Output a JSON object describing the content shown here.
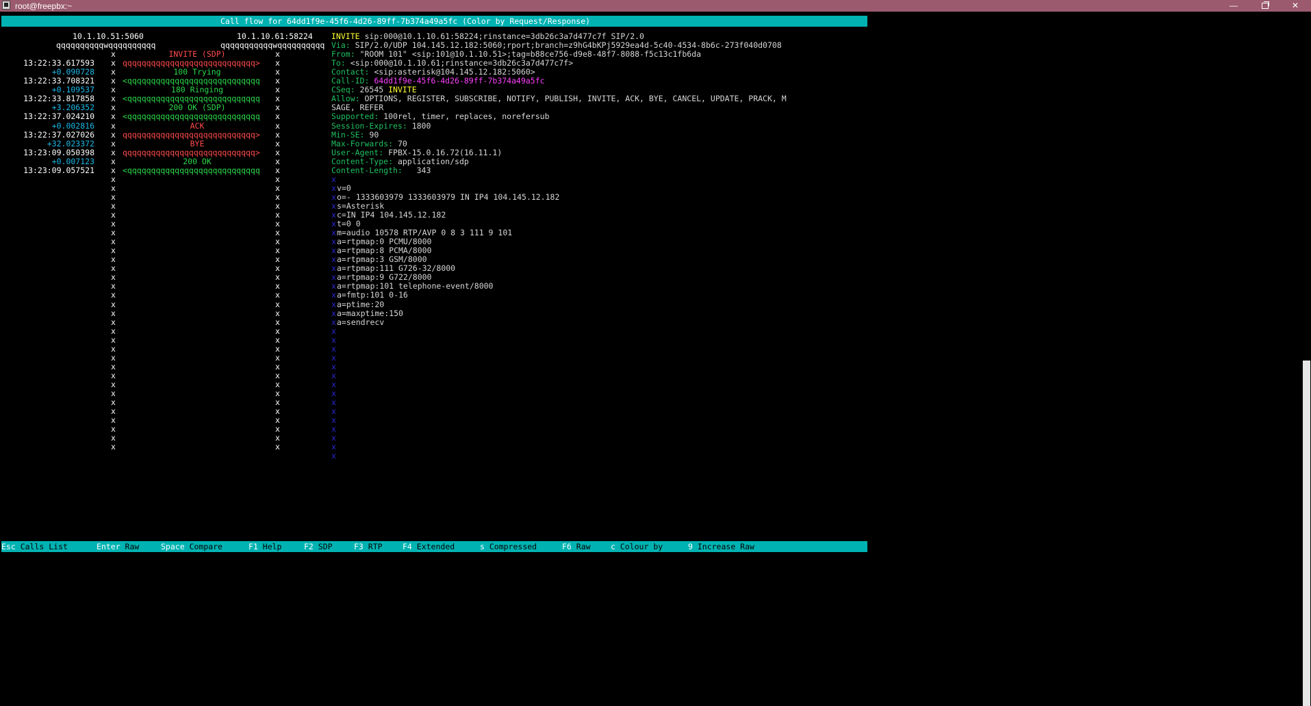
{
  "window": {
    "title": "root@freepbx:~",
    "minimize": "—",
    "close": "✕"
  },
  "header": {
    "text": "Call flow for 64dd1f9e-45f6-4d26-89ff-7b374a49a5fc (Color by Request/Response)"
  },
  "flow": {
    "hosts": [
      "10.1.10.51:5060",
      "10.1.10.61:58224"
    ],
    "host_underline_1": "qqqqqqqqqqwqqqqqqqqqq",
    "host_underline_2": "qqqqqqqqqqqwqqqqqqqqqq",
    "arrow_right": "qqqqqqqqqqqqqqqqqqqqqqqqqqqq>",
    "arrow_left": "<qqqqqqqqqqqqqqqqqqqqqqqqqqqq",
    "vline": "x",
    "events": [
      {
        "label": "INVITE (SDP)",
        "color": "red",
        "dir": "right",
        "time": "13:22:33.617593",
        "delta": "+0.090728"
      },
      {
        "label": "100 Trying",
        "color": "green",
        "dir": "left",
        "time": "13:22:33.708321",
        "delta": "+0.109537"
      },
      {
        "label": "180 Ringing",
        "color": "green",
        "dir": "left",
        "time": "13:22:33.817858",
        "delta": "+3.206352"
      },
      {
        "label": "200 OK (SDP)",
        "color": "green",
        "dir": "left",
        "time": "13:22:37.024210",
        "delta": "+0.002816"
      },
      {
        "label": "ACK",
        "color": "red",
        "dir": "right",
        "time": "13:22:37.027026",
        "delta": "+32.023372"
      },
      {
        "label": "BYE",
        "color": "red",
        "dir": "right",
        "time": "13:23:09.050398",
        "delta": "+0.007123"
      },
      {
        "label": "200 OK",
        "color": "green",
        "dir": "left",
        "time": "13:23:09.057521",
        "delta": ""
      }
    ]
  },
  "detail": {
    "request_line": {
      "method": "INVITE",
      "rest": " sip:000@10.1.10.61:58224;rinstance=3db26c3a7d477c7f SIP/2.0"
    },
    "headers": [
      {
        "name": "Via: ",
        "value": "SIP/2.0/UDP 104.145.12.182:5060;rport;branch=z9hG4bKPj5929ea4d-5c40-4534-8b6c-273f040d0708"
      },
      {
        "name": "From: ",
        "value": "\"ROOM 101\" <sip:101@10.1.10.51>;tag=b88ce756-d9e8-48f7-8088-f5c13c1fb6da"
      },
      {
        "name": "To: ",
        "value": "<sip:000@10.1.10.61;rinstance=3db26c3a7d477c7f>"
      },
      {
        "name": "Contact: ",
        "value": "<sip:asterisk@104.145.12.182:5060>"
      },
      {
        "name": "Call-ID: ",
        "value": "64dd1f9e-45f6-4d26-89ff-7b374a49a5fc",
        "style": "magenta"
      },
      {
        "name": "CSeq: ",
        "value": "26545 ",
        "extra": "INVITE"
      },
      {
        "name": "Allow: ",
        "value": "OPTIONS, REGISTER, SUBSCRIBE, NOTIFY, PUBLISH, INVITE, ACK, BYE, CANCEL, UPDATE, PRACK, M"
      },
      {
        "name": "",
        "value": "SAGE, REFER"
      },
      {
        "name": "Supported: ",
        "value": "100rel, timer, replaces, norefersub"
      },
      {
        "name": "Session-Expires: ",
        "value": "1800"
      },
      {
        "name": "Min-SE: ",
        "value": "90"
      },
      {
        "name": "Max-Forwards: ",
        "value": "70"
      },
      {
        "name": "User-Agent: ",
        "value": "FPBX-15.0.16.72(16.11.1)"
      },
      {
        "name": "Content-Type: ",
        "value": "application/sdp"
      },
      {
        "name": "Content-Length: ",
        "value": "  343"
      }
    ],
    "sdp": [
      "v=0",
      "o=- 1333603979 1333603979 IN IP4 104.145.12.182",
      "s=Asterisk",
      "c=IN IP4 104.145.12.182",
      "t=0 0",
      "m=audio 10578 RTP/AVP 0 8 3 111 9 101",
      "a=rtpmap:0 PCMU/8000",
      "a=rtpmap:8 PCMA/8000",
      "a=rtpmap:3 GSM/8000",
      "a=rtpmap:111 G726-32/8000",
      "a=rtpmap:9 G722/8000",
      "a=rtpmap:101 telephone-event/8000",
      "a=fmtp:101 0-16",
      "a=ptime:20",
      "a=maxptime:150",
      "a=sendrecv"
    ],
    "marker": "x"
  },
  "footer": {
    "keys": [
      {
        "key": "Esc",
        "label": " Calls List"
      },
      {
        "key": "Enter",
        "label": " Raw"
      },
      {
        "key": "Space",
        "label": " Compare"
      },
      {
        "key": "F1",
        "label": " Help"
      },
      {
        "key": "F2",
        "label": " SDP"
      },
      {
        "key": "F3",
        "label": " RTP"
      },
      {
        "key": "F4",
        "label": " Extended"
      },
      {
        "key": "s",
        "label": " Compressed"
      },
      {
        "key": "F6",
        "label": " Raw"
      },
      {
        "key": "c",
        "label": " Colour by"
      },
      {
        "key": "9",
        "label": " Increase Raw"
      }
    ]
  },
  "colors": {
    "bar": "#00b2b2",
    "request": "#ff4b4b",
    "response": "#2bd94a",
    "delta": "#19b8e8",
    "header_name": "#20c060",
    "method": "#ffff33",
    "call_id": "#ff40ff",
    "marker": "#2a2ad8",
    "titlebar": "#9b5a6e"
  }
}
